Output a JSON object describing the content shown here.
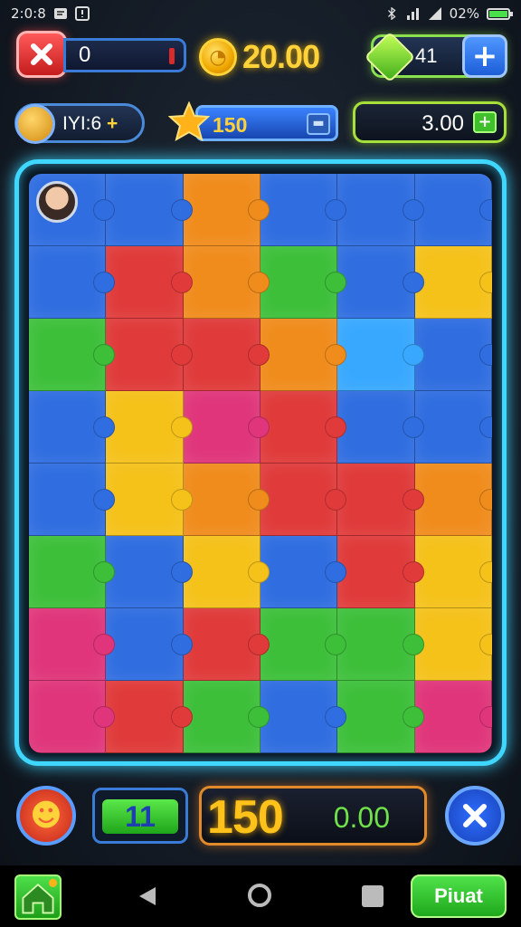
{
  "status_bar": {
    "time": "2:0:8",
    "notif_icons": [
      "message-icon",
      "alert-icon"
    ],
    "battery": "02%"
  },
  "hud_top": {
    "progress_value": "0",
    "coins": "20.00",
    "gems": "41"
  },
  "hud_second": {
    "level": "IYI:6",
    "level_plus": "+",
    "stars": "150",
    "timer": "3.00"
  },
  "board": {
    "columns": 6,
    "rows": 8,
    "pieces": [
      "#2f6de0",
      "#2f6de0",
      "#f08c1c",
      "#2f6de0",
      "#2f6de0",
      "#2f6de0",
      "#2f6de0",
      "#e03a3a",
      "#f08c1c",
      "#3dbf3a",
      "#2f6de0",
      "#f5c21a",
      "#3dbf3a",
      "#e03a3a",
      "#e03a3a",
      "#f08c1c",
      "#38a8ff",
      "#2f6de0",
      "#2f6de0",
      "#f5c21a",
      "#e0357a",
      "#e03a3a",
      "#2f6de0",
      "#2f6de0",
      "#2f6de0",
      "#f5c21a",
      "#f08c1c",
      "#e03a3a",
      "#e03a3a",
      "#f08c1c",
      "#3dbf3a",
      "#2f6de0",
      "#f5c21a",
      "#2f6de0",
      "#e03a3a",
      "#f5c21a",
      "#e0357a",
      "#2f6de0",
      "#e03a3a",
      "#3dbf3a",
      "#3dbf3a",
      "#f5c21a",
      "#e0357a",
      "#e03a3a",
      "#3dbf3a",
      "#2f6de0",
      "#3dbf3a",
      "#e0357a"
    ]
  },
  "hud_bottom": {
    "moves": "11",
    "score": "150",
    "score_sub": "0.00"
  },
  "nav": {
    "action_label": "Piuat"
  },
  "colors": {
    "board_glow": "#3fd6ff",
    "coin_gold": "#ffd23a",
    "accent_green": "#4fe24a"
  }
}
